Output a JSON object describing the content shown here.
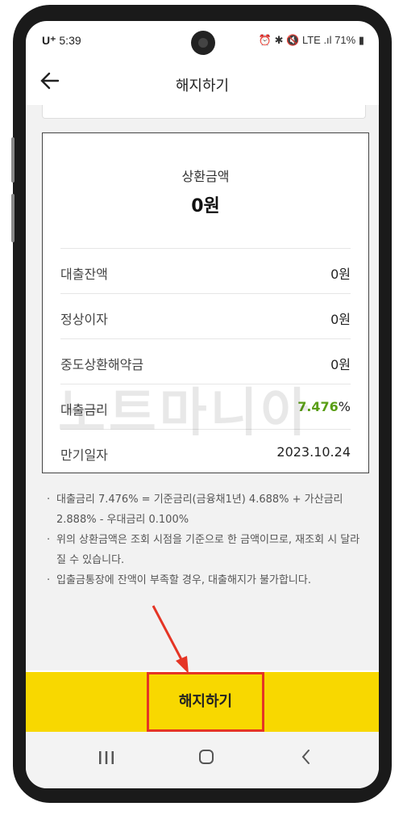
{
  "status_bar": {
    "carrier": "U⁺",
    "time": "5:39",
    "icons_text": "⏰ ✱ 🔇 LTE .ıl",
    "battery": "71%"
  },
  "header": {
    "back_icon": "arrow-left-icon",
    "title": "해지하기"
  },
  "summary": {
    "repay_label": "상환금액",
    "repay_value": "0원",
    "rows": [
      {
        "label": "대출잔액",
        "value": "0원"
      },
      {
        "label": "정상이자",
        "value": "0원"
      },
      {
        "label": "중도상환해약금",
        "value": "0원"
      },
      {
        "label": "대출금리",
        "value_highlight": "7.476",
        "value_suffix": "%"
      },
      {
        "label": "만기일자",
        "value": "2023.10.24"
      }
    ]
  },
  "watermark": "노트마니아",
  "notes": [
    "대출금리 7.476% = 기준금리(금융채1년) 4.688% + 가산금리 2.888% - 우대금리 0.100%",
    "위의 상환금액은 조회 시점을 기준으로 한 금액이므로, 재조회 시 달라질 수 있습니다.",
    "입출금통장에 잔액이 부족할 경우, 대출해지가 불가합니다."
  ],
  "cta": {
    "label": "해지하기"
  },
  "nav": {
    "recents_icon": "recents-icon",
    "home_icon": "home-icon",
    "back_icon": "back-chevron-icon"
  },
  "colors": {
    "accent": "#f8d800",
    "highlight_border": "#e53525",
    "rate_green": "#5a9e16"
  }
}
